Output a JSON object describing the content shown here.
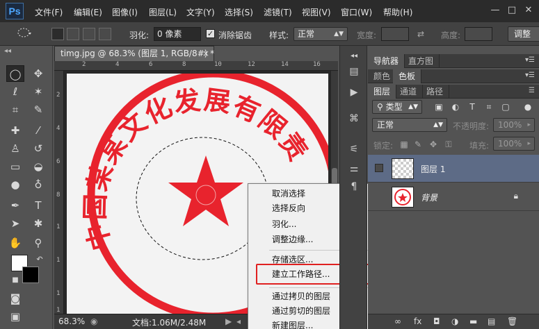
{
  "app": {
    "logo": "Ps"
  },
  "menubar": {
    "items": [
      "文件(F)",
      "编辑(E)",
      "图像(I)",
      "图层(L)",
      "文字(Y)",
      "选择(S)",
      "滤镜(T)",
      "视图(V)",
      "窗口(W)",
      "帮助(H)"
    ],
    "window_controls": {
      "minimize": "—",
      "restore": "□",
      "close": "✕"
    }
  },
  "options": {
    "feather_label": "羽化:",
    "feather_value": "0 像素",
    "antialias_label": "消除锯齿",
    "antialias_checked": true,
    "style_label": "样式:",
    "style_value": "正常",
    "width_label": "宽度:",
    "height_label": "高度:",
    "refine_label": "调整"
  },
  "document": {
    "tab_title": "timg.jpg @ 68.3% (图层 1, RGB/8#) *",
    "tab_close": "×",
    "ruler_h": [
      "2",
      "4",
      "6",
      "8",
      "10",
      "12",
      "14",
      "16"
    ],
    "ruler_v": [
      "2",
      "4",
      "6",
      "8",
      "1",
      "1",
      "1",
      "1"
    ],
    "stamp_text": "中国某某文化发展有限责任公司",
    "zoom": "68.3%",
    "doc_info": "文档:1.06M/2.48M"
  },
  "context_menu": {
    "items": [
      "取消选择",
      "选择反向",
      "羽化...",
      "调整边缘...",
      "存储选区...",
      "建立工作路径...",
      "通过拷贝的图层",
      "通过剪切的图层",
      "新建图层..."
    ],
    "highlighted": "建立工作路径...",
    "highlight_color": "#e02020"
  },
  "panels": {
    "group1_tabs": [
      "导航器",
      "直方图"
    ],
    "group2_tabs": [
      "颜色",
      "色板"
    ],
    "group3_tabs": [
      "图层",
      "通道",
      "路径"
    ],
    "filter_value": "类型",
    "blend_mode": "正常",
    "opacity_label": "不透明度:",
    "opacity_value": "100%",
    "lock_label": "锁定:",
    "fill_label": "填充:",
    "fill_value": "100%",
    "layers": [
      {
        "name": "图层 1",
        "selected": true,
        "italic": false,
        "locked": false
      },
      {
        "name": "背景",
        "selected": false,
        "italic": true,
        "locked": true
      }
    ],
    "footer_icons": [
      "∞",
      "fx"
    ]
  },
  "colors": {
    "stamp_red": "#e8232d",
    "foreground": "#ffffff",
    "background": "#000000",
    "selected_layer": "#5d6b86"
  }
}
